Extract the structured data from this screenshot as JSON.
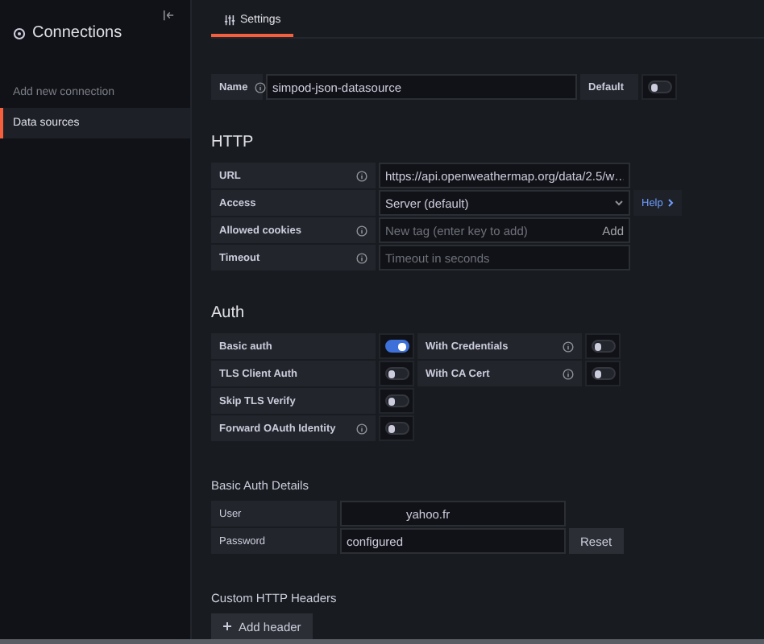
{
  "sidebar": {
    "title": "Connections",
    "items": [
      {
        "label": "Add new connection",
        "selected": false
      },
      {
        "label": "Data sources",
        "selected": true
      }
    ]
  },
  "tabs": [
    {
      "label": "Settings",
      "selected": true
    }
  ],
  "name_field": {
    "label": "Name",
    "value": "simpod-json-datasource",
    "default_label": "Default",
    "default_on": false
  },
  "http": {
    "heading": "HTTP",
    "rows": [
      {
        "kind": "text",
        "label": "URL",
        "info": true,
        "value": "https://api.openweathermap.org/data/2.5/w…"
      },
      {
        "kind": "select",
        "label": "Access",
        "info": false,
        "value": "Server (default)",
        "help": "Help"
      },
      {
        "kind": "tags",
        "label": "Allowed cookies",
        "info": true,
        "placeholder": "New tag (enter key to add)",
        "action": "Add"
      },
      {
        "kind": "text",
        "label": "Timeout",
        "info": true,
        "placeholder": "Timeout in seconds"
      }
    ]
  },
  "auth": {
    "heading": "Auth",
    "rows": [
      {
        "label": "Basic auth",
        "info": false,
        "on": true,
        "extra": {
          "label": "With Credentials",
          "info": true,
          "on": false
        }
      },
      {
        "label": "TLS Client Auth",
        "info": false,
        "on": false,
        "extra": {
          "label": "With CA Cert",
          "info": true,
          "on": false
        }
      },
      {
        "label": "Skip TLS Verify",
        "info": false,
        "on": false
      },
      {
        "label": "Forward OAuth Identity",
        "info": true,
        "on": false
      }
    ]
  },
  "basic_auth": {
    "heading": "Basic Auth Details",
    "user": {
      "label": "User",
      "value": "yahoo.fr"
    },
    "password": {
      "label": "Password",
      "value": "configured",
      "action": "Reset"
    }
  },
  "headers": {
    "heading": "Custom HTTP Headers",
    "button": "Add header"
  }
}
